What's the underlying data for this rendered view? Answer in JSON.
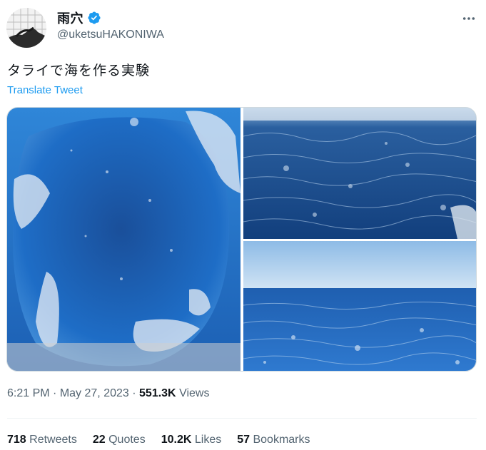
{
  "author": {
    "display_name": "雨穴",
    "handle": "@uketsuHAKONIWA",
    "verified_icon": "verified-badge-icon",
    "avatar_icon": "avatar-icon"
  },
  "tweet": {
    "text": "タライで海を作る実験",
    "translate_label": "Translate Tweet"
  },
  "media": {
    "photos": [
      {
        "icon": "photo-icon"
      },
      {
        "icon": "photo-icon"
      },
      {
        "icon": "photo-icon"
      }
    ]
  },
  "meta": {
    "time": "6:21 PM",
    "separator": "·",
    "date": "May 27, 2023",
    "views_count": "551.3K",
    "views_label": "Views"
  },
  "stats": {
    "retweets_count": "718",
    "retweets_label": "Retweets",
    "quotes_count": "22",
    "quotes_label": "Quotes",
    "likes_count": "10.2K",
    "likes_label": "Likes",
    "bookmarks_count": "57",
    "bookmarks_label": "Bookmarks"
  },
  "colors": {
    "link_blue": "#1d9bf0",
    "secondary_text": "#536471",
    "primary_text": "#0f1419",
    "water_blue": "#1f6fc4",
    "sky_blue": "#a9cdea"
  }
}
